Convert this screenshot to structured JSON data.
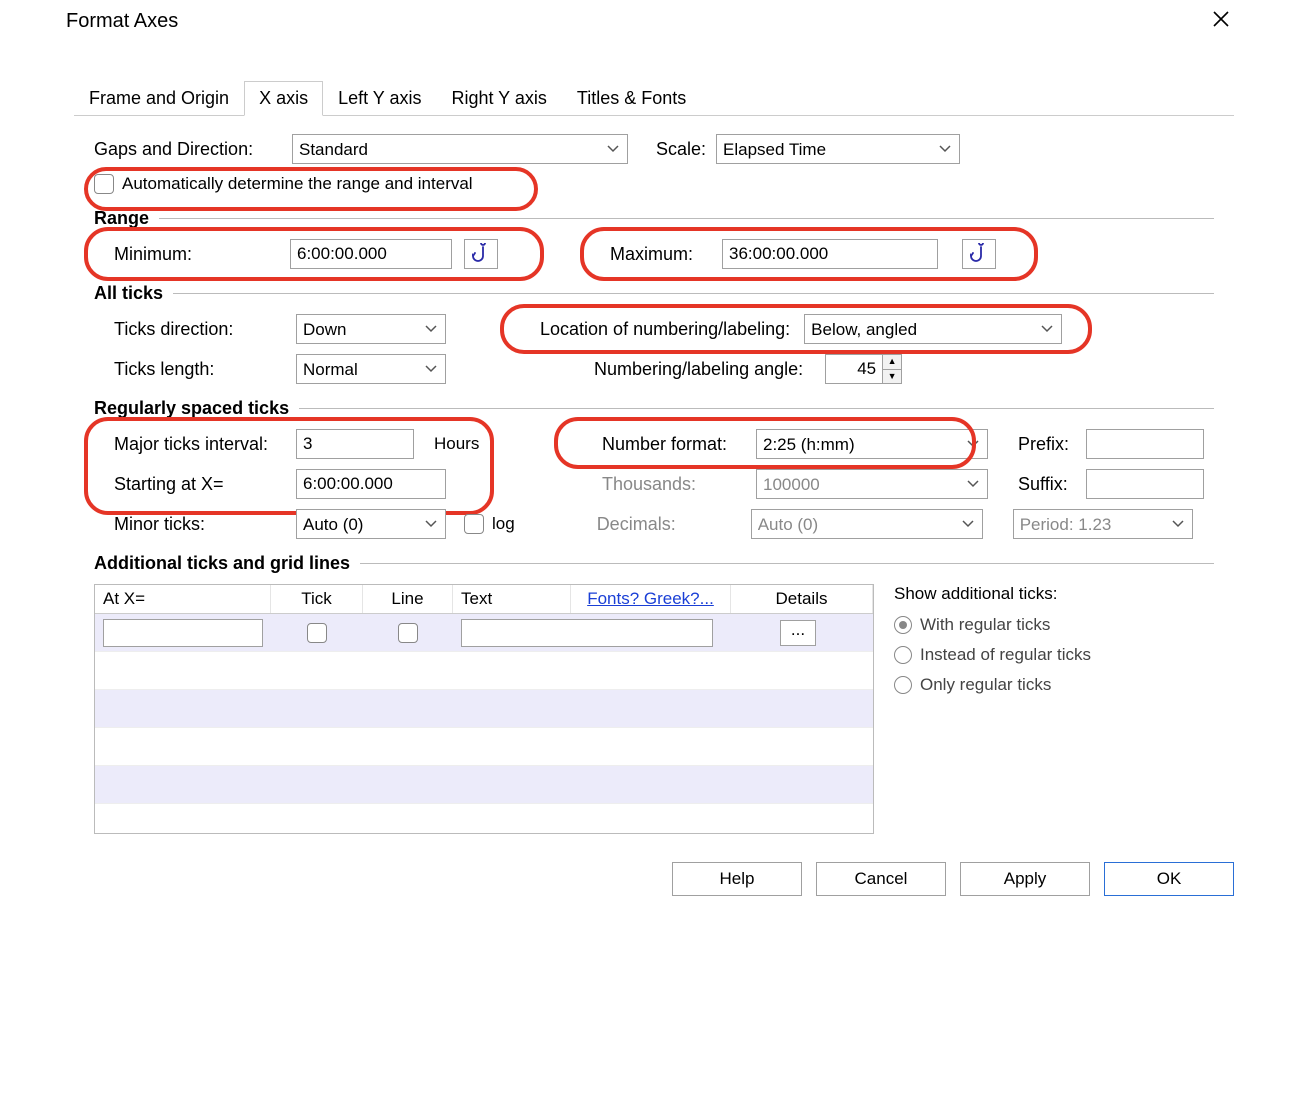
{
  "title": "Format Axes",
  "tabs": [
    "Frame and Origin",
    "X axis",
    "Left Y axis",
    "Right Y axis",
    "Titles & Fonts"
  ],
  "active_tab": "X axis",
  "gaps_direction_label": "Gaps and Direction:",
  "gaps_direction_value": "Standard",
  "scale_label": "Scale:",
  "scale_value": "Elapsed Time",
  "auto_range_label": "Automatically determine the range and interval",
  "range": {
    "title": "Range",
    "min_label": "Minimum:",
    "min_value": "6:00:00.000",
    "max_label": "Maximum:",
    "max_value": "36:00:00.000"
  },
  "all_ticks": {
    "title": "All ticks",
    "dir_label": "Ticks direction:",
    "dir_value": "Down",
    "loc_label": "Location of numbering/labeling:",
    "loc_value": "Below, angled",
    "len_label": "Ticks length:",
    "len_value": "Normal",
    "angle_label": "Numbering/labeling angle:",
    "angle_value": "45"
  },
  "reg_ticks": {
    "title": "Regularly spaced ticks",
    "major_label": "Major ticks interval:",
    "major_value": "3",
    "major_unit": "Hours",
    "numfmt_label": "Number format:",
    "numfmt_value": "2:25 (h:mm)",
    "prefix_label": "Prefix:",
    "prefix_value": "",
    "start_label": "Starting at X=",
    "start_value": "6:00:00.000",
    "thousands_label": "Thousands:",
    "thousands_value": "100000",
    "suffix_label": "Suffix:",
    "suffix_value": "",
    "minor_label": "Minor ticks:",
    "minor_value": "Auto (0)",
    "log_label": "log",
    "decimals_label": "Decimals:",
    "decimals_value": "Auto (0)",
    "period_label": "Period: 1.23"
  },
  "additional": {
    "title": "Additional ticks and grid lines",
    "cols": {
      "atx": "At X=",
      "tick": "Tick",
      "line": "Line",
      "text": "Text",
      "fonts": "Fonts? Greek?...",
      "details": "Details"
    },
    "details_btn": "...",
    "show_label": "Show additional ticks:",
    "opt_with": "With regular ticks",
    "opt_instead": "Instead of regular ticks",
    "opt_only": "Only regular ticks"
  },
  "footer": {
    "help": "Help",
    "cancel": "Cancel",
    "apply": "Apply",
    "ok": "OK"
  }
}
